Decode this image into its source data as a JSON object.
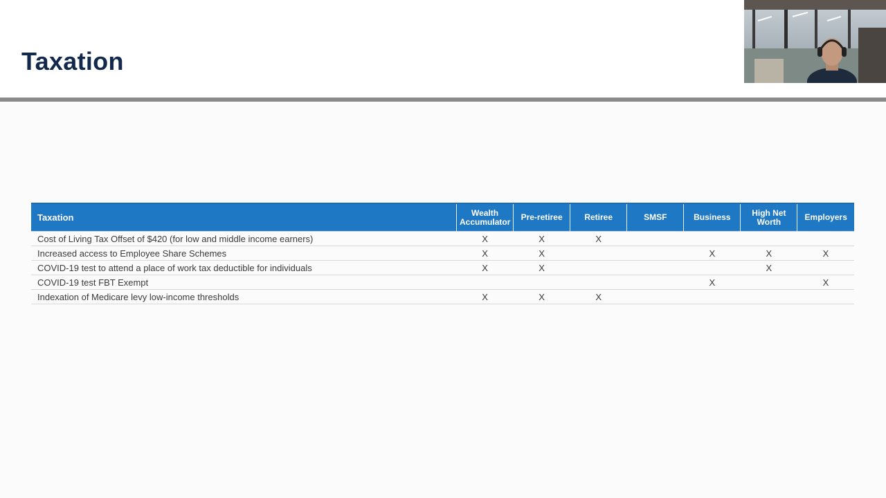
{
  "slide": {
    "title": "Taxation"
  },
  "table": {
    "header": {
      "first": "Taxation",
      "columns": [
        {
          "line1": "Wealth",
          "line2": "Accumulator"
        },
        {
          "line1": "Pre-retiree",
          "line2": ""
        },
        {
          "line1": "Retiree",
          "line2": ""
        },
        {
          "line1": "SMSF",
          "line2": ""
        },
        {
          "line1": "Business",
          "line2": ""
        },
        {
          "line1": "High Net",
          "line2": "Worth"
        },
        {
          "line1": "Employers",
          "line2": ""
        }
      ]
    },
    "rows": [
      {
        "label": "Cost of Living Tax Offset of $420 (for low and middle income earners)",
        "cells": [
          "X",
          "X",
          "X",
          "",
          "",
          "",
          ""
        ]
      },
      {
        "label": "Increased access to Employee Share Schemes",
        "cells": [
          "X",
          "X",
          "",
          "",
          "X",
          "X",
          "X"
        ]
      },
      {
        "label": "COVID-19 test to attend a place of work tax deductible for individuals",
        "cells": [
          "X",
          "X",
          "",
          "",
          "",
          "X",
          ""
        ]
      },
      {
        "label": "COVID-19 test FBT Exempt",
        "cells": [
          "",
          "",
          "",
          "",
          "X",
          "",
          "X"
        ]
      },
      {
        "label": "Indexation of Medicare levy low-income thresholds",
        "cells": [
          "X",
          "X",
          "X",
          "",
          "",
          "",
          ""
        ]
      }
    ]
  },
  "video": {
    "icon": "presenter-video-feed"
  },
  "colors": {
    "title": "#13294b",
    "header_bg": "#1f78c4",
    "rule": "#8a8a8a"
  }
}
